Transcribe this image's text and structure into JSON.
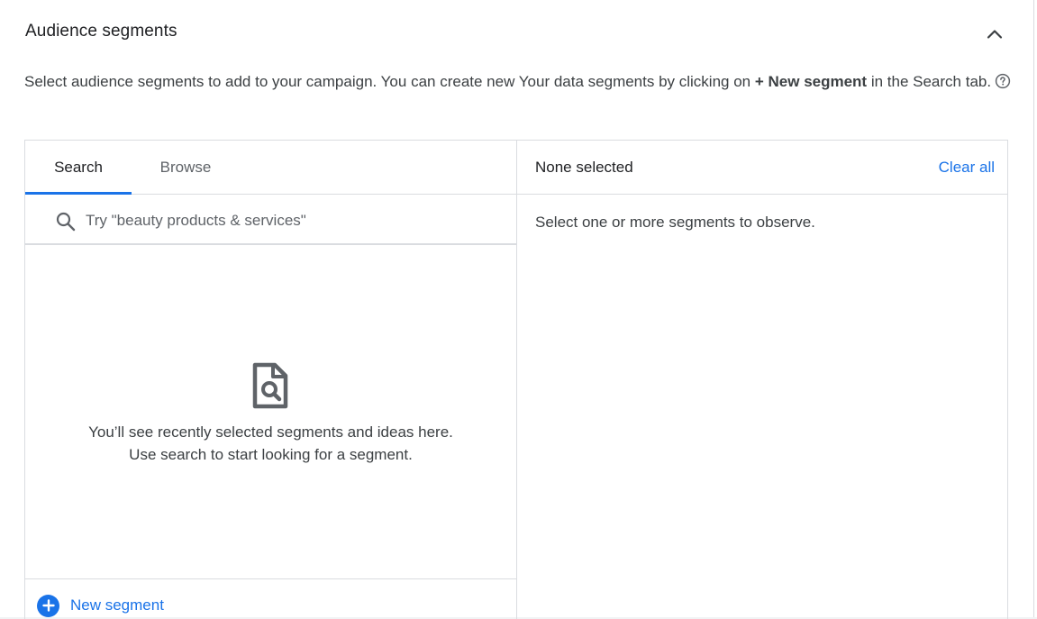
{
  "section": {
    "title": "Audience segments",
    "description_prefix": "Select audience segments to add to your campaign. You can create new Your data segments by clicking on ",
    "description_bold": "+ New segment",
    "description_suffix": " in the Search tab.",
    "collapse_icon": "chevron-up-icon",
    "help_icon": "help-circle-icon"
  },
  "left_pane": {
    "tabs": [
      {
        "label": "Search",
        "active": true
      },
      {
        "label": "Browse",
        "active": false
      }
    ],
    "search": {
      "placeholder": "Try \"beauty products & services\"",
      "value": "",
      "icon": "search-icon"
    },
    "empty_state": {
      "icon": "document-search-icon",
      "line1": "You’ll see recently selected segments and ideas here.",
      "line2": "Use search to start looking for a segment."
    },
    "footer": {
      "new_segment_label": "New segment",
      "icon": "add-circle-icon"
    }
  },
  "right_pane": {
    "header": "None selected",
    "clear_all": "Clear all",
    "hint": "Select one or more segments to observe."
  },
  "colors": {
    "accent": "#1a73e8",
    "text": "#3c4043",
    "border": "#dadce0"
  }
}
